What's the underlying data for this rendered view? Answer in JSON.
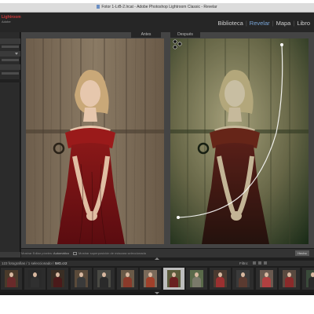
{
  "window": {
    "title": "Fotor 1-LrB-2.lrcat - Adobe Photoshop Lightroom Classic - Revelar"
  },
  "topbar": {
    "logo_text": "Lightroom",
    "logo_sub": "Adobe",
    "modules": [
      {
        "label": "Biblioteca",
        "active": false
      },
      {
        "label": "Revelar",
        "active": true
      },
      {
        "label": "Mapa",
        "active": false
      },
      {
        "label": "Libro",
        "active": false
      }
    ]
  },
  "compare": {
    "before_label": "Antes",
    "after_label": "Después"
  },
  "toolbar": {
    "effect_label": "Mostrar Editar píxeles:",
    "effect_value": "Automático",
    "overlay_label": "Mostrar superposición de máscara seleccionada",
    "done_button": "Hecho"
  },
  "filmstrip": {
    "count_text": "123 fotografías / 1 seleccionado /",
    "filename": "IMG.cr2",
    "filter_label": "Filtro:",
    "selected_index": 7,
    "thumbnails": [
      {
        "bg": "#4a3a2a",
        "dress": "#6a2a2a"
      },
      {
        "bg": "#2a2a2a",
        "dress": "#303030"
      },
      {
        "bg": "#3a2e24",
        "dress": "#4a1a1a"
      },
      {
        "bg": "#5a4a3a",
        "dress": "#3a3a3a"
      },
      {
        "bg": "#4a4a44",
        "dress": "#2a2a2a"
      },
      {
        "bg": "#6a5a48",
        "dress": "#8a3a2a"
      },
      {
        "bg": "#7a6a5a",
        "dress": "#a0402a"
      },
      {
        "bg": "#5a5a3a",
        "dress": "#6a2020"
      },
      {
        "bg": "#5a6a4a",
        "dress": "#7a7a6a"
      },
      {
        "bg": "#4a3a30",
        "dress": "#9a3030"
      },
      {
        "bg": "#3a3a3a",
        "dress": "#5a3a30"
      },
      {
        "bg": "#6a5a50",
        "dress": "#b04040"
      },
      {
        "bg": "#5a4a40",
        "dress": "#8a2a2a"
      },
      {
        "bg": "#3a4a3a",
        "dress": "#2a2a2a"
      }
    ]
  },
  "colors": {
    "accent": "#7aa6d8",
    "panel": "#2b2b2b",
    "background": "#444444"
  }
}
